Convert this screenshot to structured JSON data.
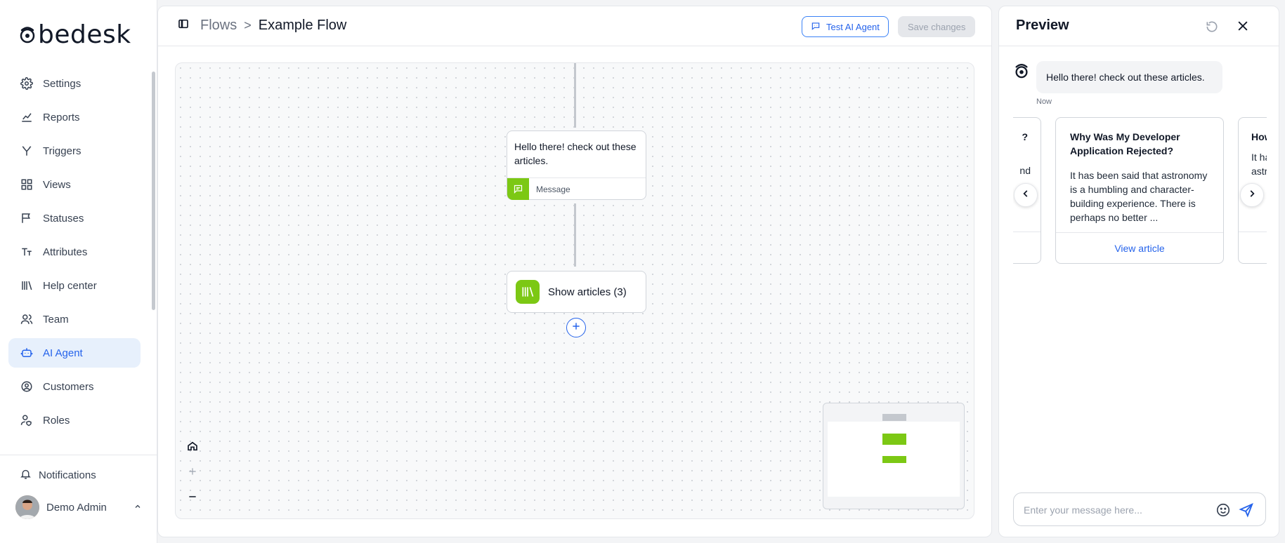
{
  "app": {
    "logo_text": "bedesk"
  },
  "sidebar": {
    "items": [
      {
        "label": "Settings",
        "icon": "gear-icon"
      },
      {
        "label": "Reports",
        "icon": "chart-icon"
      },
      {
        "label": "Triggers",
        "icon": "branch-icon"
      },
      {
        "label": "Views",
        "icon": "grid-icon"
      },
      {
        "label": "Statuses",
        "icon": "flag-icon"
      },
      {
        "label": "Attributes",
        "icon": "text-size-icon"
      },
      {
        "label": "Help center",
        "icon": "library-icon"
      },
      {
        "label": "Team",
        "icon": "users-icon"
      },
      {
        "label": "AI Agent",
        "icon": "bot-icon",
        "active": true
      },
      {
        "label": "Customers",
        "icon": "user-circle-icon"
      },
      {
        "label": "Roles",
        "icon": "user-shield-icon"
      }
    ],
    "notifications_label": "Notifications",
    "user_name": "Demo Admin"
  },
  "header": {
    "breadcrumb_parent": "Flows",
    "breadcrumb_separator": ">",
    "title": "Example Flow",
    "test_button_label": "Test AI Agent",
    "save_button_label": "Save changes"
  },
  "flow": {
    "message_node": {
      "text": "Hello there! check out these articles.",
      "type_label": "Message"
    },
    "articles_node": {
      "label": "Show articles (3)"
    }
  },
  "preview": {
    "title": "Preview",
    "bot_message": "Hello there! check out these articles.",
    "timestamp": "Now",
    "prev_card": {
      "title_fragment": "?",
      "body_fragment": "nd"
    },
    "card": {
      "title": "Why Was My Developer Application Rejected?",
      "body": "It has been said that astronomy is a humbling and character-building experience. There is perhaps no better ...",
      "link_label": "View article"
    },
    "next_card": {
      "title_fragment": "How",
      "body_fragment_1": "It ha",
      "body_fragment_2": "astr"
    },
    "composer_placeholder": "Enter your message here..."
  },
  "colors": {
    "accent": "#2563eb",
    "node_green": "#7cc814",
    "active_bg": "#e7f0fc"
  }
}
